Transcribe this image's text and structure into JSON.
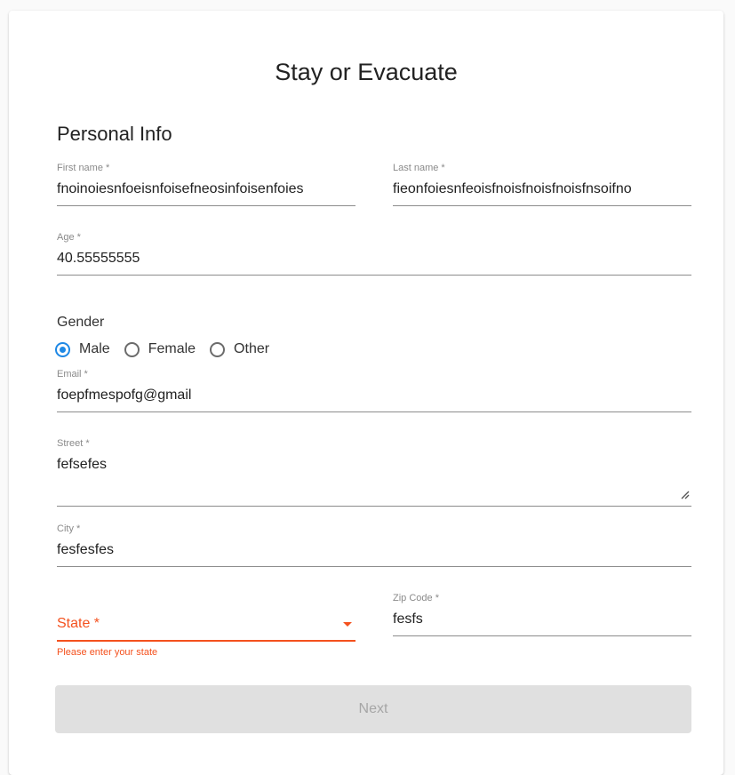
{
  "form": {
    "title": "Stay or Evacuate",
    "section_title": "Personal Info",
    "first_name": {
      "label": "First name *",
      "value": "fnoinoiesnfoeisnfoisefneosinfoisenfoies"
    },
    "last_name": {
      "label": "Last name *",
      "value": "fieonfoiesnfeoisfnoisfnoisfnoisfnsoifno"
    },
    "age": {
      "label": "Age *",
      "value": "40.55555555"
    },
    "gender": {
      "label": "Gender",
      "options": [
        "Male",
        "Female",
        "Other"
      ],
      "selected": "Male"
    },
    "email": {
      "label": "Email *",
      "value": "foepfmespofg@gmail"
    },
    "street": {
      "label": "Street *",
      "value": "fefsefes"
    },
    "city": {
      "label": "City *",
      "value": "fesfesfes"
    },
    "state": {
      "label": "State *",
      "error": "Please enter your state"
    },
    "zip": {
      "label": "Zip Code *",
      "value": "fesfs"
    },
    "next_label": "Next"
  },
  "colors": {
    "accent": "#1e88e5",
    "error": "#f4511e",
    "disabled_bg": "#e0e0e0",
    "disabled_text": "#a6a6a6"
  }
}
